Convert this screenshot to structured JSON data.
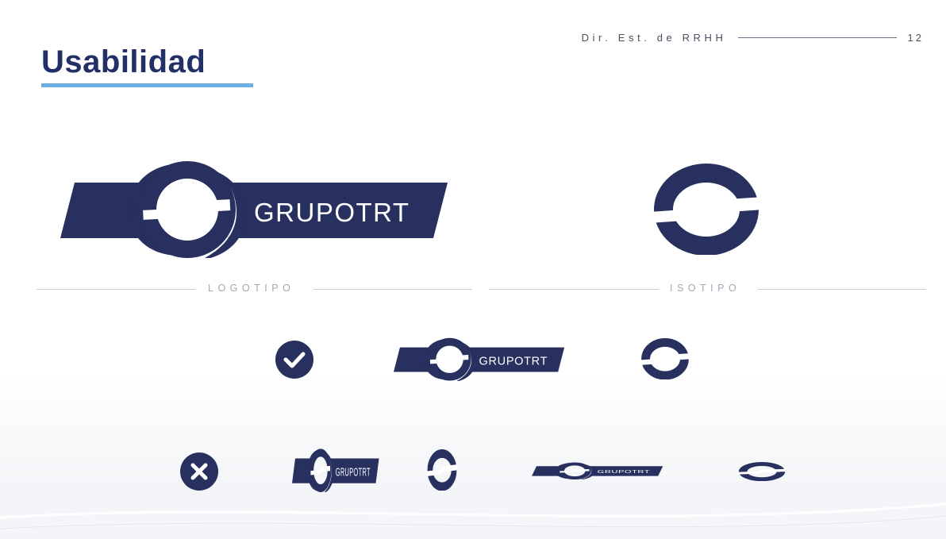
{
  "slide": {
    "title": "Usabilidad",
    "department": "Dir. Est. de RRHH",
    "page_number": "12"
  },
  "logo": {
    "wordmark": "GRUPOTRT"
  },
  "sections": {
    "logotype_label": "LOGOTIPO",
    "isotype_label": "ISOTIPO"
  },
  "colors": {
    "brand_navy": "#27305f",
    "accent_blue": "#6aaee6",
    "divider_gray": "#c9ccd4"
  },
  "icons": {
    "correct": "check-circle-icon",
    "incorrect": "x-circle-icon"
  }
}
